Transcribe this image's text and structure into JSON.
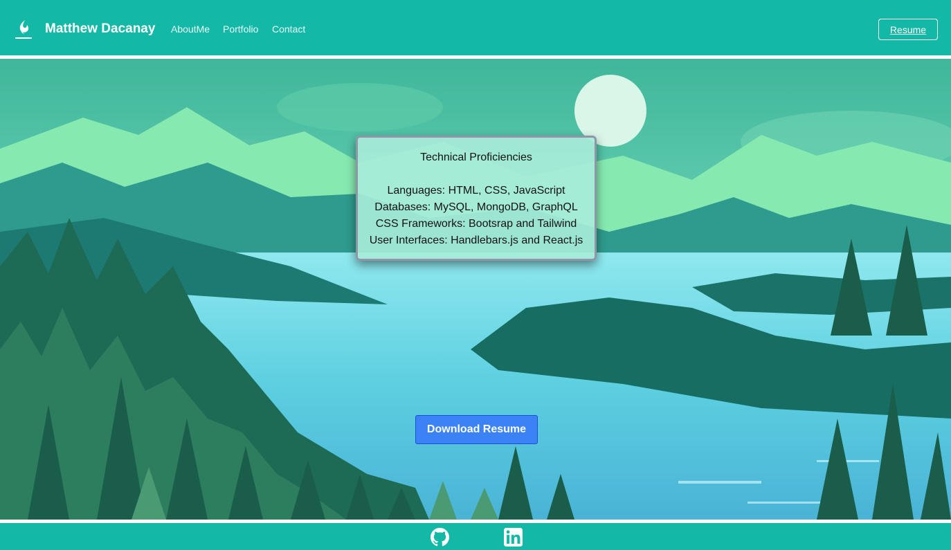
{
  "header": {
    "brand": "Matthew Dacanay",
    "nav": [
      {
        "label": "AboutMe"
      },
      {
        "label": "Portfolio"
      },
      {
        "label": "Contact"
      }
    ],
    "resume_label": "Resume",
    "logo_icon": "flame-logo-icon"
  },
  "card": {
    "title": "Technical Proficiencies",
    "lines": [
      "Languages: HTML, CSS, JavaScript",
      "Databases: MySQL, MongoDB, GraphQL",
      "CSS Frameworks: Bootsrap and Tailwind",
      "User Interfaces: Handlebars.js and React.js"
    ]
  },
  "download_label": "Download Resume",
  "footer": {
    "icons": [
      "github-icon",
      "linkedin-icon"
    ]
  },
  "colors": {
    "teal": "#14b8a6",
    "button_blue": "#3b82f6",
    "card_bg": "#a7ecd9"
  }
}
